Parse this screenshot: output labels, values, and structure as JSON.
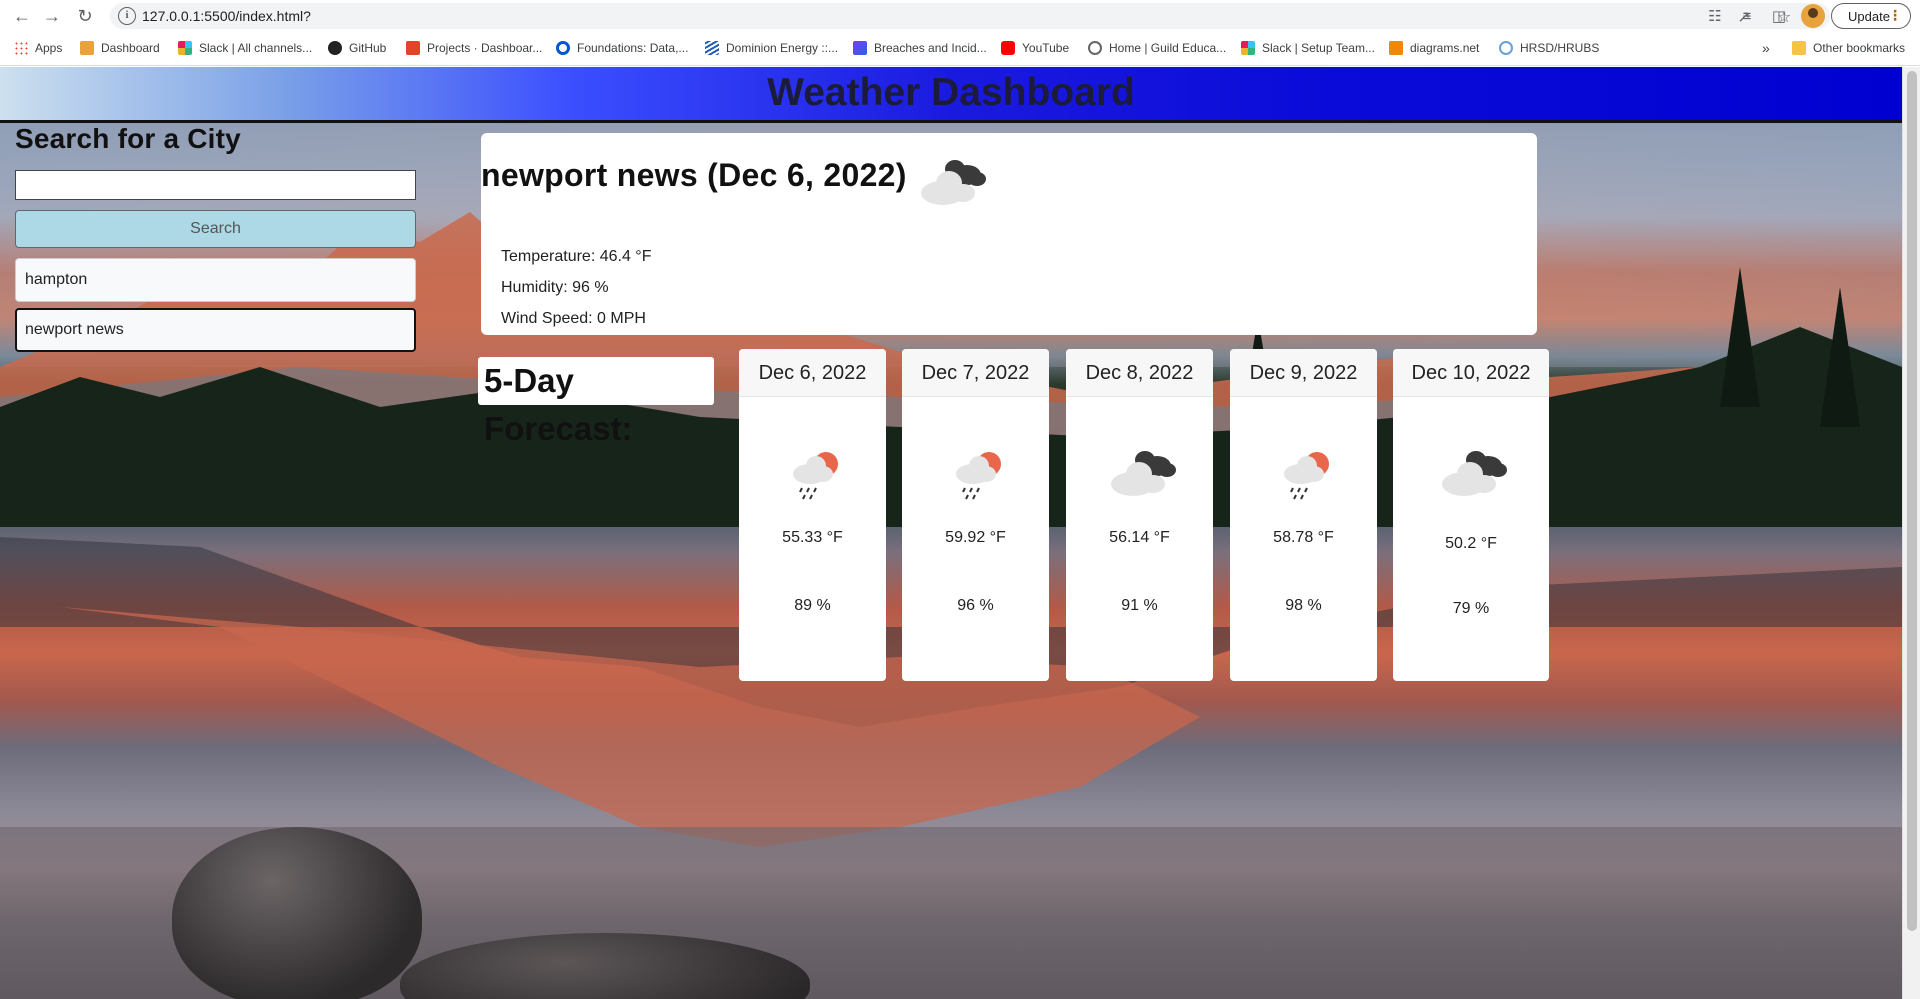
{
  "browser": {
    "url": "127.0.0.1:5500/index.html?",
    "update_label": "Update",
    "bookmarks": [
      {
        "label": "Apps"
      },
      {
        "label": "Dashboard"
      },
      {
        "label": "Slack | All channels..."
      },
      {
        "label": "GitHub"
      },
      {
        "label": "Projects · Dashboar..."
      },
      {
        "label": "Foundations: Data,..."
      },
      {
        "label": "Dominion Energy ::..."
      },
      {
        "label": "Breaches and Incid..."
      },
      {
        "label": "YouTube"
      },
      {
        "label": "Home | Guild Educa..."
      },
      {
        "label": "Slack | Setup Team..."
      },
      {
        "label": "diagrams.net"
      },
      {
        "label": "HRSD/HRUBS"
      }
    ],
    "overflow_label": "»",
    "other_bookmarks": "Other bookmarks"
  },
  "header": {
    "title": "Weather Dashboard"
  },
  "search": {
    "title": "Search for a City",
    "input_value": "",
    "button_label": "Search",
    "history": [
      "hampton",
      "newport news"
    ]
  },
  "current": {
    "title": "newport news (Dec 6, 2022)",
    "icon": "cloudy-icon",
    "temperature": "Temperature: 46.4 °F",
    "humidity": "Humidity: 96 %",
    "wind": "Wind Speed: 0 MPH"
  },
  "forecast": {
    "label": "5-Day Forecast:",
    "days": [
      {
        "date": "Dec 6, 2022",
        "icon": "rain-sun-icon",
        "temp": "55.33 °F",
        "humidity": "89 %"
      },
      {
        "date": "Dec 7, 2022",
        "icon": "rain-sun-icon",
        "temp": "59.92 °F",
        "humidity": "96 %"
      },
      {
        "date": "Dec 8, 2022",
        "icon": "cloudy-icon",
        "temp": "56.14 °F",
        "humidity": "91 %"
      },
      {
        "date": "Dec 9, 2022",
        "icon": "rain-sun-icon",
        "temp": "58.78 °F",
        "humidity": "98 %"
      },
      {
        "date": "Dec 10, 2022",
        "icon": "cloudy-icon",
        "temp": "50.2 °F",
        "humidity": "79 %"
      }
    ]
  },
  "colors": {
    "header_gradient_end": "#0000d0",
    "search_button": "#add8e6",
    "sun": "#e8674a"
  }
}
